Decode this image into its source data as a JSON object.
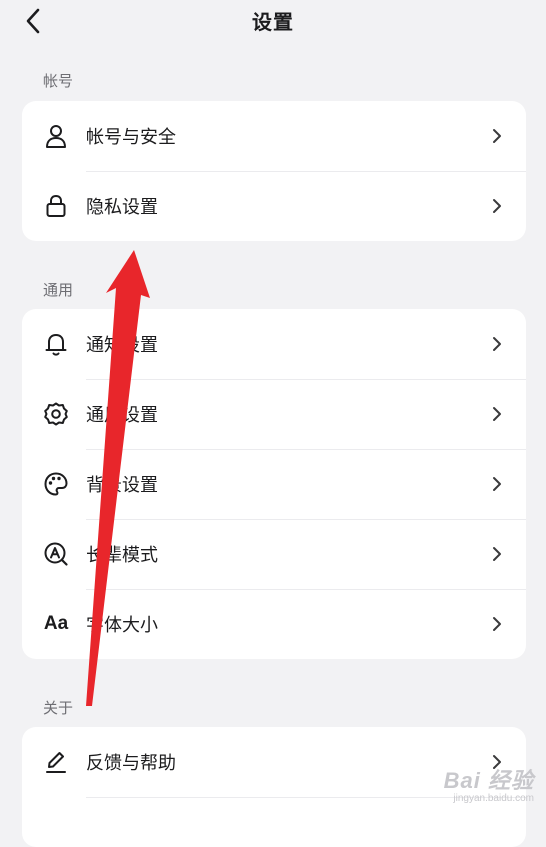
{
  "header": {
    "title": "设置"
  },
  "sections": [
    {
      "label": "帐号",
      "items": [
        {
          "label": "帐号与安全",
          "icon": "user-icon"
        },
        {
          "label": "隐私设置",
          "icon": "lock-icon"
        }
      ]
    },
    {
      "label": "通用",
      "items": [
        {
          "label": "通知设置",
          "icon": "bell-icon"
        },
        {
          "label": "通用设置",
          "icon": "gear-icon"
        },
        {
          "label": "背景设置",
          "icon": "palette-icon"
        },
        {
          "label": "长辈模式",
          "icon": "elder-mode-icon"
        },
        {
          "label": "字体大小",
          "icon": "font-size-icon",
          "glyph": "Aa"
        }
      ]
    },
    {
      "label": "关于",
      "items": [
        {
          "label": "反馈与帮助",
          "icon": "pencil-icon"
        }
      ]
    }
  ],
  "annotation": {
    "arrow_color": "#e8262b"
  },
  "watermark": {
    "main": "Bai 经验",
    "sub": "jingyan.baidu.com"
  }
}
